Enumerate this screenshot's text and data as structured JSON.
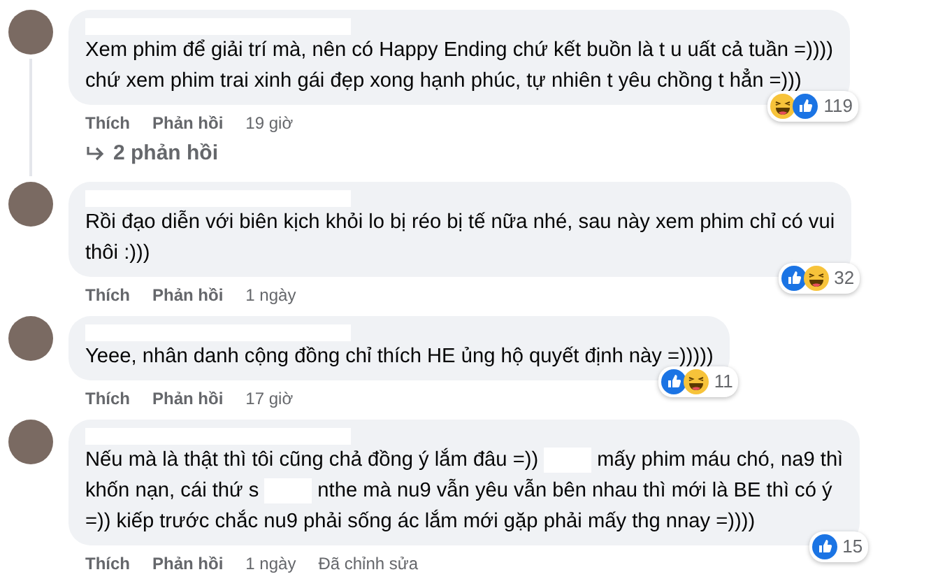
{
  "comments": [
    {
      "lines": [
        [
          {
            "kind": "text",
            "text": "Xem phim để giải trí mà, nên có Happy Ending chứ kết buồn là t u uất cả tuần =))))"
          }
        ],
        [
          {
            "kind": "text",
            "text": "chứ xem phim trai xinh gái đẹp xong hạnh phúc, tự nhiên t yêu chồng t hẳn =)))"
          }
        ]
      ],
      "reactions": [
        {
          "kind": "haha"
        },
        {
          "kind": "like"
        }
      ],
      "reaction_count": "119",
      "like": "Thích",
      "reply": "Phản hồi",
      "time": "19 giờ",
      "replies_link": "2 phản hồi"
    },
    {
      "lines": [
        [
          {
            "kind": "text",
            "text": "Rồi đạo diễn với biên kịch khỏi lo bị réo bị tế nữa nhé, sau này xem phim chỉ có vui"
          }
        ],
        [
          {
            "kind": "text",
            "text": "thôi :)))"
          }
        ]
      ],
      "reactions": [
        {
          "kind": "like"
        },
        {
          "kind": "haha"
        }
      ],
      "reaction_count": "32",
      "like": "Thích",
      "reply": "Phản hồi",
      "time": "1 ngày"
    },
    {
      "lines": [
        [
          {
            "kind": "text",
            "text": "Yeee, nhân danh cộng đồng chỉ thích HE ủng hộ quyết định này =)))))"
          }
        ]
      ],
      "reactions": [
        {
          "kind": "like"
        },
        {
          "kind": "haha"
        }
      ],
      "reaction_count": "11",
      "like": "Thích",
      "reply": "Phản hồi",
      "time": "17 giờ"
    },
    {
      "lines": [
        [
          {
            "kind": "text",
            "text": "Nếu mà là thật thì tôi cũng chả đồng ý lắm đâu =))"
          },
          {
            "kind": "redacted"
          },
          {
            "kind": "text",
            "text": "mấy phim máu chó, na9 thì"
          }
        ],
        [
          {
            "kind": "text",
            "text": "khốn nạn, cái thứ s"
          },
          {
            "kind": "redacted"
          },
          {
            "kind": "text",
            "text": "nthe mà nu9 vẫn yêu vẫn bên nhau thì mới là BE thì có ý"
          }
        ],
        [
          {
            "kind": "text",
            "text": "=)) kiếp trước chắc nu9 phải sống ác lắm mới gặp phải mấy thg nnay =))))"
          }
        ]
      ],
      "reactions": [
        {
          "kind": "like"
        }
      ],
      "reaction_count": "15",
      "like": "Thích",
      "reply": "Phản hồi",
      "time": "1 ngày",
      "edited": "Đã chỉnh sửa"
    }
  ]
}
